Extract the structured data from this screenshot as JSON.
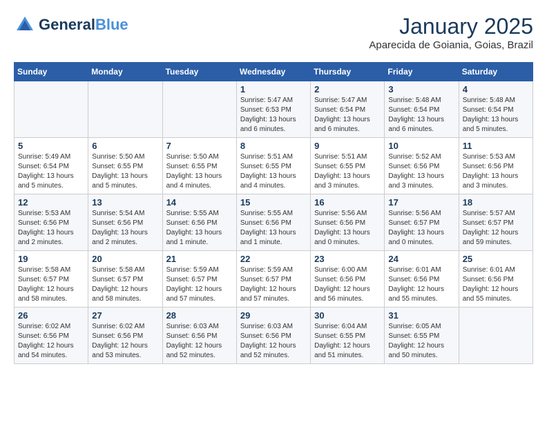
{
  "header": {
    "logo_line1": "General",
    "logo_line2": "Blue",
    "month": "January 2025",
    "location": "Aparecida de Goiania, Goias, Brazil"
  },
  "weekdays": [
    "Sunday",
    "Monday",
    "Tuesday",
    "Wednesday",
    "Thursday",
    "Friday",
    "Saturday"
  ],
  "weeks": [
    [
      {
        "day": "",
        "info": ""
      },
      {
        "day": "",
        "info": ""
      },
      {
        "day": "",
        "info": ""
      },
      {
        "day": "1",
        "info": "Sunrise: 5:47 AM\nSunset: 6:53 PM\nDaylight: 13 hours and 6 minutes."
      },
      {
        "day": "2",
        "info": "Sunrise: 5:47 AM\nSunset: 6:54 PM\nDaylight: 13 hours and 6 minutes."
      },
      {
        "day": "3",
        "info": "Sunrise: 5:48 AM\nSunset: 6:54 PM\nDaylight: 13 hours and 6 minutes."
      },
      {
        "day": "4",
        "info": "Sunrise: 5:48 AM\nSunset: 6:54 PM\nDaylight: 13 hours and 5 minutes."
      }
    ],
    [
      {
        "day": "5",
        "info": "Sunrise: 5:49 AM\nSunset: 6:54 PM\nDaylight: 13 hours and 5 minutes."
      },
      {
        "day": "6",
        "info": "Sunrise: 5:50 AM\nSunset: 6:55 PM\nDaylight: 13 hours and 5 minutes."
      },
      {
        "day": "7",
        "info": "Sunrise: 5:50 AM\nSunset: 6:55 PM\nDaylight: 13 hours and 4 minutes."
      },
      {
        "day": "8",
        "info": "Sunrise: 5:51 AM\nSunset: 6:55 PM\nDaylight: 13 hours and 4 minutes."
      },
      {
        "day": "9",
        "info": "Sunrise: 5:51 AM\nSunset: 6:55 PM\nDaylight: 13 hours and 3 minutes."
      },
      {
        "day": "10",
        "info": "Sunrise: 5:52 AM\nSunset: 6:56 PM\nDaylight: 13 hours and 3 minutes."
      },
      {
        "day": "11",
        "info": "Sunrise: 5:53 AM\nSunset: 6:56 PM\nDaylight: 13 hours and 3 minutes."
      }
    ],
    [
      {
        "day": "12",
        "info": "Sunrise: 5:53 AM\nSunset: 6:56 PM\nDaylight: 13 hours and 2 minutes."
      },
      {
        "day": "13",
        "info": "Sunrise: 5:54 AM\nSunset: 6:56 PM\nDaylight: 13 hours and 2 minutes."
      },
      {
        "day": "14",
        "info": "Sunrise: 5:55 AM\nSunset: 6:56 PM\nDaylight: 13 hours and 1 minute."
      },
      {
        "day": "15",
        "info": "Sunrise: 5:55 AM\nSunset: 6:56 PM\nDaylight: 13 hours and 1 minute."
      },
      {
        "day": "16",
        "info": "Sunrise: 5:56 AM\nSunset: 6:56 PM\nDaylight: 13 hours and 0 minutes."
      },
      {
        "day": "17",
        "info": "Sunrise: 5:56 AM\nSunset: 6:57 PM\nDaylight: 13 hours and 0 minutes."
      },
      {
        "day": "18",
        "info": "Sunrise: 5:57 AM\nSunset: 6:57 PM\nDaylight: 12 hours and 59 minutes."
      }
    ],
    [
      {
        "day": "19",
        "info": "Sunrise: 5:58 AM\nSunset: 6:57 PM\nDaylight: 12 hours and 58 minutes."
      },
      {
        "day": "20",
        "info": "Sunrise: 5:58 AM\nSunset: 6:57 PM\nDaylight: 12 hours and 58 minutes."
      },
      {
        "day": "21",
        "info": "Sunrise: 5:59 AM\nSunset: 6:57 PM\nDaylight: 12 hours and 57 minutes."
      },
      {
        "day": "22",
        "info": "Sunrise: 5:59 AM\nSunset: 6:57 PM\nDaylight: 12 hours and 57 minutes."
      },
      {
        "day": "23",
        "info": "Sunrise: 6:00 AM\nSunset: 6:56 PM\nDaylight: 12 hours and 56 minutes."
      },
      {
        "day": "24",
        "info": "Sunrise: 6:01 AM\nSunset: 6:56 PM\nDaylight: 12 hours and 55 minutes."
      },
      {
        "day": "25",
        "info": "Sunrise: 6:01 AM\nSunset: 6:56 PM\nDaylight: 12 hours and 55 minutes."
      }
    ],
    [
      {
        "day": "26",
        "info": "Sunrise: 6:02 AM\nSunset: 6:56 PM\nDaylight: 12 hours and 54 minutes."
      },
      {
        "day": "27",
        "info": "Sunrise: 6:02 AM\nSunset: 6:56 PM\nDaylight: 12 hours and 53 minutes."
      },
      {
        "day": "28",
        "info": "Sunrise: 6:03 AM\nSunset: 6:56 PM\nDaylight: 12 hours and 52 minutes."
      },
      {
        "day": "29",
        "info": "Sunrise: 6:03 AM\nSunset: 6:56 PM\nDaylight: 12 hours and 52 minutes."
      },
      {
        "day": "30",
        "info": "Sunrise: 6:04 AM\nSunset: 6:55 PM\nDaylight: 12 hours and 51 minutes."
      },
      {
        "day": "31",
        "info": "Sunrise: 6:05 AM\nSunset: 6:55 PM\nDaylight: 12 hours and 50 minutes."
      },
      {
        "day": "",
        "info": ""
      }
    ]
  ]
}
